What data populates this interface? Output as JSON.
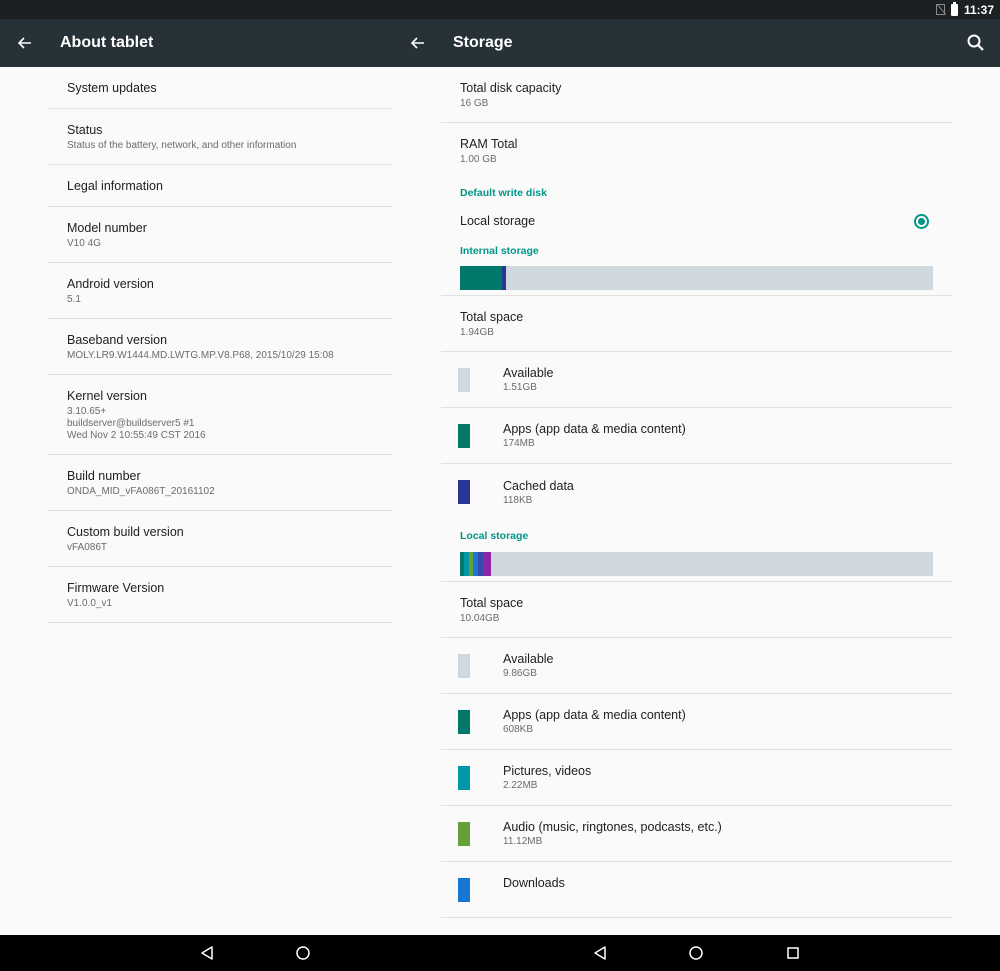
{
  "status_bar": {
    "time": "11:37",
    "icons": [
      "no-sim-icon",
      "battery-icon"
    ]
  },
  "left_panel": {
    "title": "About tablet",
    "items": [
      {
        "title": "System updates",
        "summary": ""
      },
      {
        "title": "Status",
        "summary": "Status of the battery, network, and other information"
      },
      {
        "title": "Legal information",
        "summary": ""
      },
      {
        "title": "Model number",
        "summary": "V10 4G"
      },
      {
        "title": "Android version",
        "summary": "5.1"
      },
      {
        "title": "Baseband version",
        "summary": "MOLY.LR9.W1444.MD.LWTG.MP.V8.P68, 2015/10/29 15:08"
      },
      {
        "title": "Kernel version",
        "summary": "3.10.65+\nbuildserver@buildserver5 #1\nWed Nov 2 10:55:49 CST 2016"
      },
      {
        "title": "Build number",
        "summary": "ONDA_MID_vFA086T_20161102"
      },
      {
        "title": "Custom build version",
        "summary": "vFA086T"
      },
      {
        "title": "Firmware Version",
        "summary": "V1.0.0_v1"
      }
    ]
  },
  "right_panel": {
    "title": "Storage",
    "total_disk": {
      "title": "Total disk capacity",
      "summary": "16 GB"
    },
    "ram": {
      "title": "RAM Total",
      "summary": "1.00 GB"
    },
    "default_write_header": "Default write disk",
    "default_write_option": {
      "label": "Local storage",
      "selected": true
    },
    "internal": {
      "header": "Internal storage",
      "bar_segments": [
        {
          "color": "#00796b",
          "fraction": 0.088
        },
        {
          "color": "#283593",
          "fraction": 0.009
        }
      ],
      "total": {
        "title": "Total space",
        "summary": "1.94GB"
      },
      "categories": [
        {
          "label": "Available",
          "value": "1.51GB",
          "color": "#cfd8dc"
        },
        {
          "label": "Apps (app data & media content)",
          "value": "174MB",
          "color": "#00796b"
        },
        {
          "label": "Cached data",
          "value": "118KB",
          "color": "#283593"
        }
      ]
    },
    "local": {
      "header": "Local storage",
      "bar_segments": [
        {
          "color": "#00796b",
          "fraction": 0.008
        },
        {
          "color": "#0097a7",
          "fraction": 0.01
        },
        {
          "color": "#689f38",
          "fraction": 0.01
        },
        {
          "color": "#1976d2",
          "fraction": 0.01
        },
        {
          "color": "#3949ab",
          "fraction": 0.01
        },
        {
          "color": "#8e24aa",
          "fraction": 0.018
        }
      ],
      "total": {
        "title": "Total space",
        "summary": "10.04GB"
      },
      "categories": [
        {
          "label": "Available",
          "value": "9.86GB",
          "color": "#cfd8dc"
        },
        {
          "label": "Apps (app data & media content)",
          "value": "608KB",
          "color": "#00796b"
        },
        {
          "label": "Pictures, videos",
          "value": "2.22MB",
          "color": "#0097a7"
        },
        {
          "label": "Audio (music, ringtones, podcasts, etc.)",
          "value": "11.12MB",
          "color": "#689f38"
        },
        {
          "label": "Downloads",
          "value": "",
          "color": "#1976d2"
        }
      ]
    }
  },
  "nav_bar": {
    "buttons": [
      "back-icon",
      "home-icon",
      "recents-icon"
    ]
  }
}
